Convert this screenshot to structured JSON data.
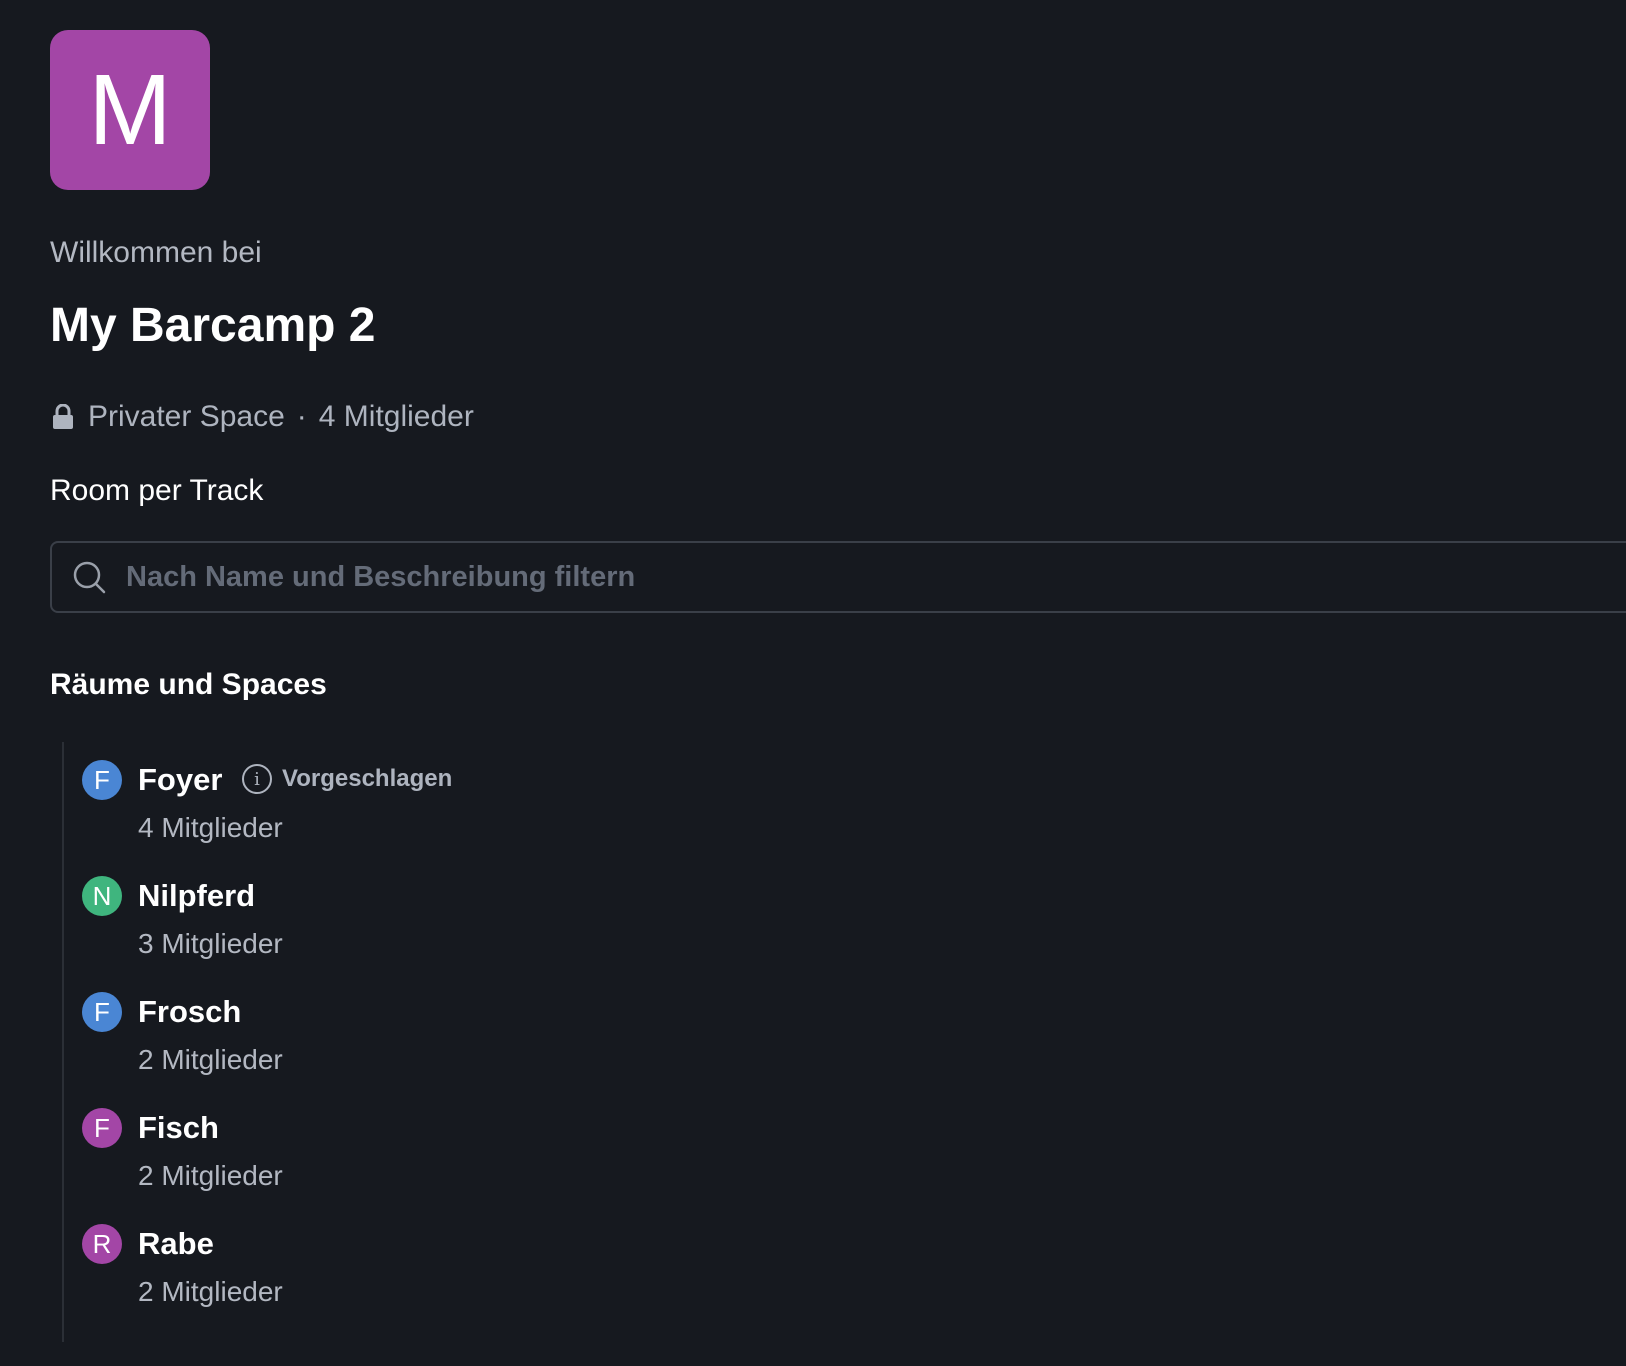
{
  "space": {
    "avatar_letter": "M",
    "avatar_color": "#a346a6",
    "welcome": "Willkommen bei",
    "name": "My Barcamp 2",
    "visibility": "Privater Space",
    "separator": "·",
    "member_count": "4 Mitglieder",
    "topic": "Room per Track"
  },
  "search": {
    "placeholder": "Nach Name und Beschreibung filtern",
    "value": ""
  },
  "rooms_section": {
    "title": "Räume und Spaces",
    "rooms": [
      {
        "letter": "F",
        "color": "#4a86d4",
        "name": "Foyer",
        "members": "4 Mitglieder",
        "badge": "Vorgeschlagen",
        "badge_icon": "info-icon"
      },
      {
        "letter": "N",
        "color": "#3fb57e",
        "name": "Nilpferd",
        "members": "3 Mitglieder"
      },
      {
        "letter": "F",
        "color": "#4a86d4",
        "name": "Frosch",
        "members": "2 Mitglieder"
      },
      {
        "letter": "F",
        "color": "#a346a6",
        "name": "Fisch",
        "members": "2 Mitglieder"
      },
      {
        "letter": "R",
        "color": "#a346a6",
        "name": "Rabe",
        "members": "2 Mitglieder"
      }
    ]
  },
  "icons": {
    "lock": "lock-icon",
    "search": "search-icon"
  }
}
